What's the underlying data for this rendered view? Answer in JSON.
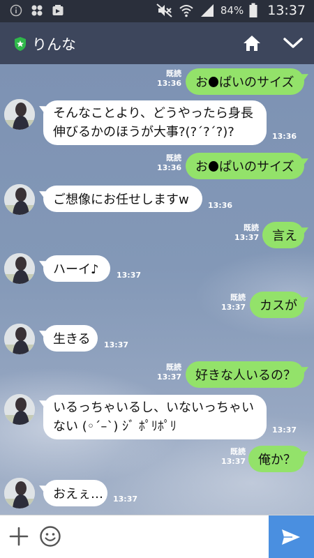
{
  "status_bar": {
    "battery_percent": "84%",
    "time": "13:37"
  },
  "header": {
    "title": "りんな"
  },
  "messages": [
    {
      "dir": "out",
      "read": "既読",
      "time": "13:36",
      "text_pre": "お",
      "text_post": "ぱいのサイズ",
      "redacted": true
    },
    {
      "dir": "in",
      "time": "13:36",
      "lines": [
        "そんなことより、どうやったら身長",
        "伸びるかのほうが大事?(?´?´?)?"
      ]
    },
    {
      "dir": "out",
      "read": "既読",
      "time": "13:36",
      "text_pre": "お",
      "text_post": "ぱいのサイズ",
      "redacted": true
    },
    {
      "dir": "in",
      "time": "13:36",
      "text": "ご想像にお任せしますw"
    },
    {
      "dir": "out",
      "read": "既読",
      "time": "13:37",
      "text": "言え"
    },
    {
      "dir": "in",
      "time": "13:37",
      "text": "ハーイ♪"
    },
    {
      "dir": "out",
      "read": "既読",
      "time": "13:37",
      "text": "カスが"
    },
    {
      "dir": "in",
      "time": "13:37",
      "text": "生きる"
    },
    {
      "dir": "out",
      "read": "既読",
      "time": "13:37",
      "text": "好きな人いるの？"
    },
    {
      "dir": "in",
      "time": "13:37",
      "lines": [
        "いるっちゃいるし、いないっちゃい",
        "ない (◦´–`) ｼﾞ ﾎﾟﾘﾎﾟﾘ"
      ]
    },
    {
      "dir": "out",
      "read": "既読",
      "time": "13:37",
      "text": "俺か？"
    },
    {
      "dir": "in",
      "time": "13:37",
      "text": "おえぇ…"
    }
  ],
  "icons": {
    "status_left": [
      "info-icon",
      "flower-icon",
      "photo-icon"
    ],
    "status_right": [
      "mute-icon",
      "wifi-icon",
      "signal-icon",
      "battery-icon"
    ],
    "header": [
      "shield-icon",
      "home-icon",
      "chevron-down-icon"
    ],
    "input": [
      "plus-icon",
      "emoji-icon",
      "send-icon"
    ]
  },
  "colors": {
    "outgoing_bubble": "#93e26a",
    "incoming_bubble": "#ffffff",
    "header_bg": "#3d465c",
    "send_button": "#4a8fe0"
  }
}
